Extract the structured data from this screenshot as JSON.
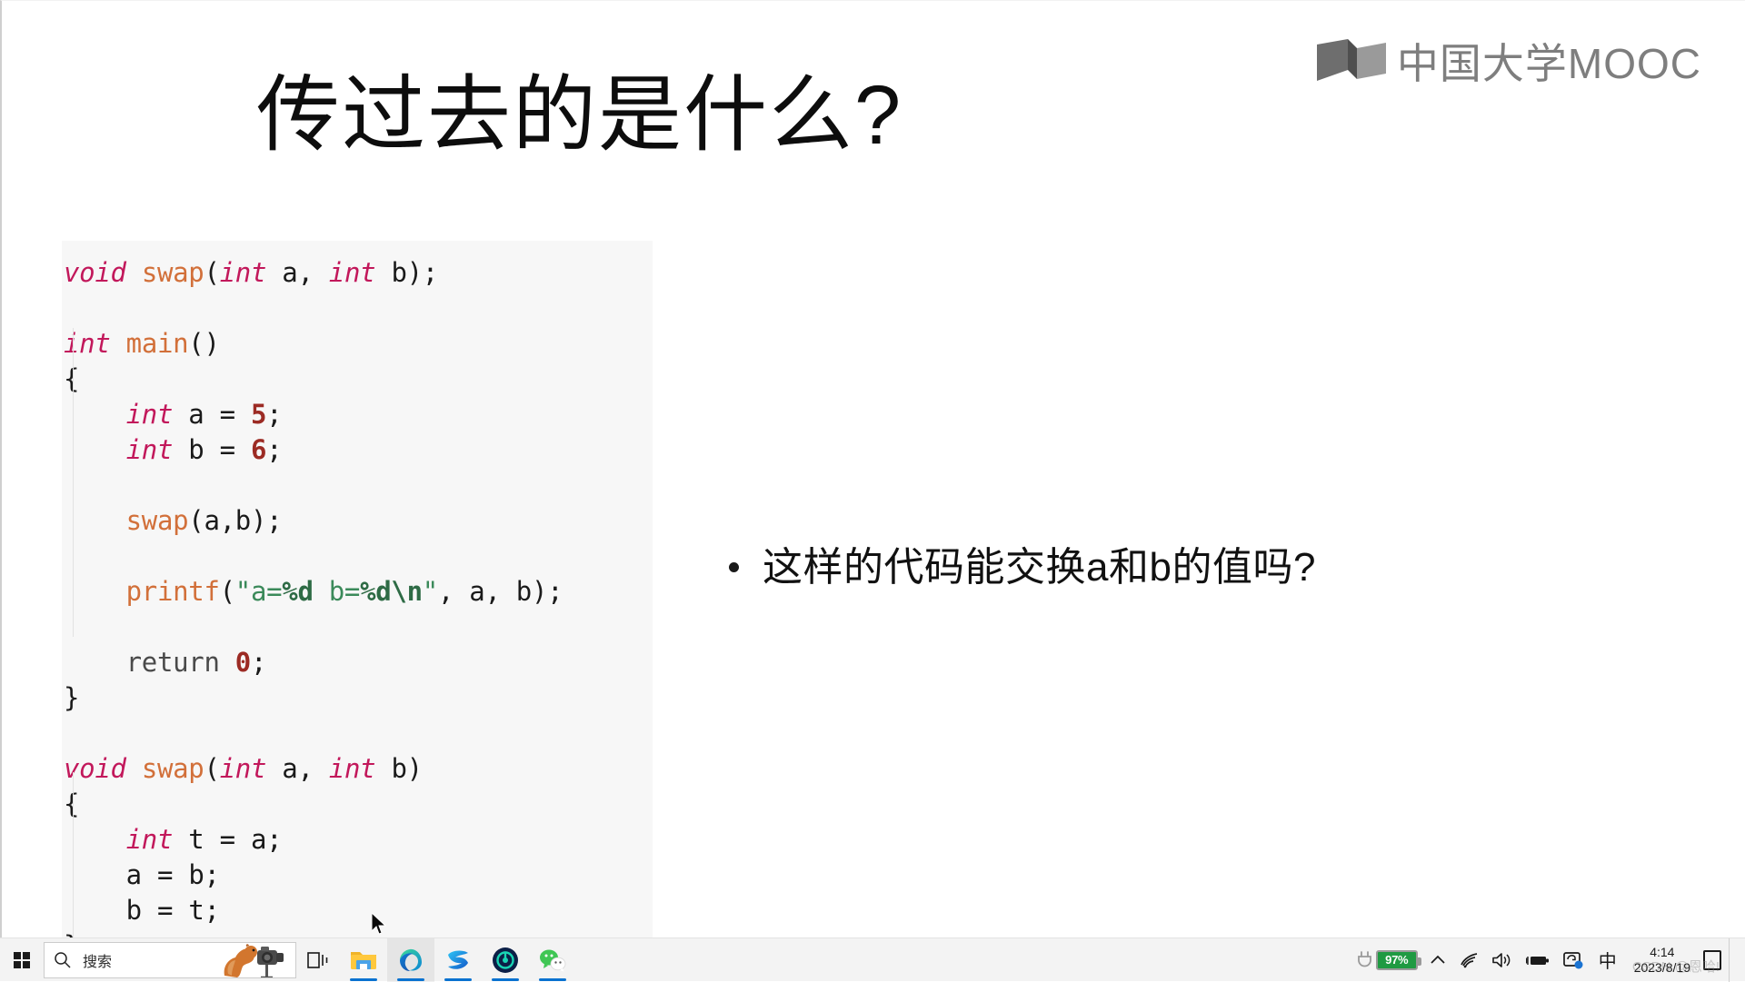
{
  "slide": {
    "title": "传过去的是什么?",
    "logo": {
      "text": "中国大学MOOC",
      "mark_name": "open-book-mark",
      "color_dark": "#6e6e6e",
      "color_light": "#9a9a9a"
    },
    "bullet": {
      "text": "这样的代码能交换a和b的值吗?"
    },
    "code": {
      "language": "c",
      "background": "#f7f7f7",
      "lines": [
        "void swap(int a, int b);",
        "",
        "int main()",
        "{",
        "    int a = 5;",
        "    int b = 6;",
        "",
        "    swap(a,b);",
        "",
        "    printf(\"a=%d b=%d\\n\", a, b);",
        "",
        "    return 0;",
        "}",
        "",
        "void swap(int a, int b)",
        "{",
        "    int t = a;",
        "    a = b;",
        "    b = t;",
        "}"
      ],
      "colors": {
        "keyword": "#c2185b",
        "keyword_plain": "#4a4a4a",
        "function": "#d2703a",
        "number": "#9c2b24",
        "string": "#3b8a5a",
        "string_format": "#2e6b45",
        "plain": "#1a1a1a"
      }
    }
  },
  "taskbar": {
    "start_label": "start-button",
    "search": {
      "placeholder": "搜索"
    },
    "buttons": [
      {
        "name": "task-view",
        "label": "任务视图"
      },
      {
        "name": "file-explorer",
        "label": "文件资源管理器"
      },
      {
        "name": "microsoft-edge",
        "label": "Microsoft Edge"
      },
      {
        "name": "browser-z",
        "label": "浏览器"
      },
      {
        "name": "teal-app",
        "label": "应用"
      },
      {
        "name": "wechat",
        "label": "微信"
      }
    ],
    "tray": {
      "battery_percent": "97%",
      "battery_name": "battery-charging-icon",
      "overflow_name": "chevron-up-icon",
      "wifi_name": "wifi-icon",
      "volume_name": "speaker-icon",
      "battery2_name": "battery-icon",
      "onedrive_name": "onedrive-sync-icon",
      "ime_char": "中",
      "notification_name": "action-center-icon"
    },
    "clock": {
      "time": "4:14",
      "date": "2023/8/19"
    },
    "watermark": "CSDN @恩哈!"
  }
}
